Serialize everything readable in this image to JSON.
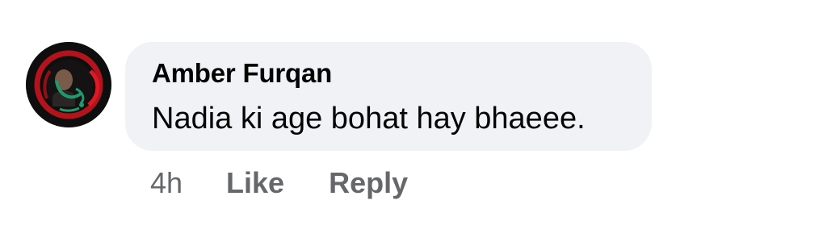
{
  "comment": {
    "author": "Amber Furqan",
    "text": "Nadia ki age bohat hay bhaeee.",
    "timestamp": "4h",
    "like_label": "Like",
    "reply_label": "Reply",
    "avatar_icon": "profile-photo-avatar-icon"
  },
  "colors": {
    "bubble_bg": "#f0f2f5",
    "text": "#050505",
    "secondary_text": "#65676b",
    "avatar_ring": "#c0151d",
    "avatar_accent": "#1f9a6e"
  }
}
